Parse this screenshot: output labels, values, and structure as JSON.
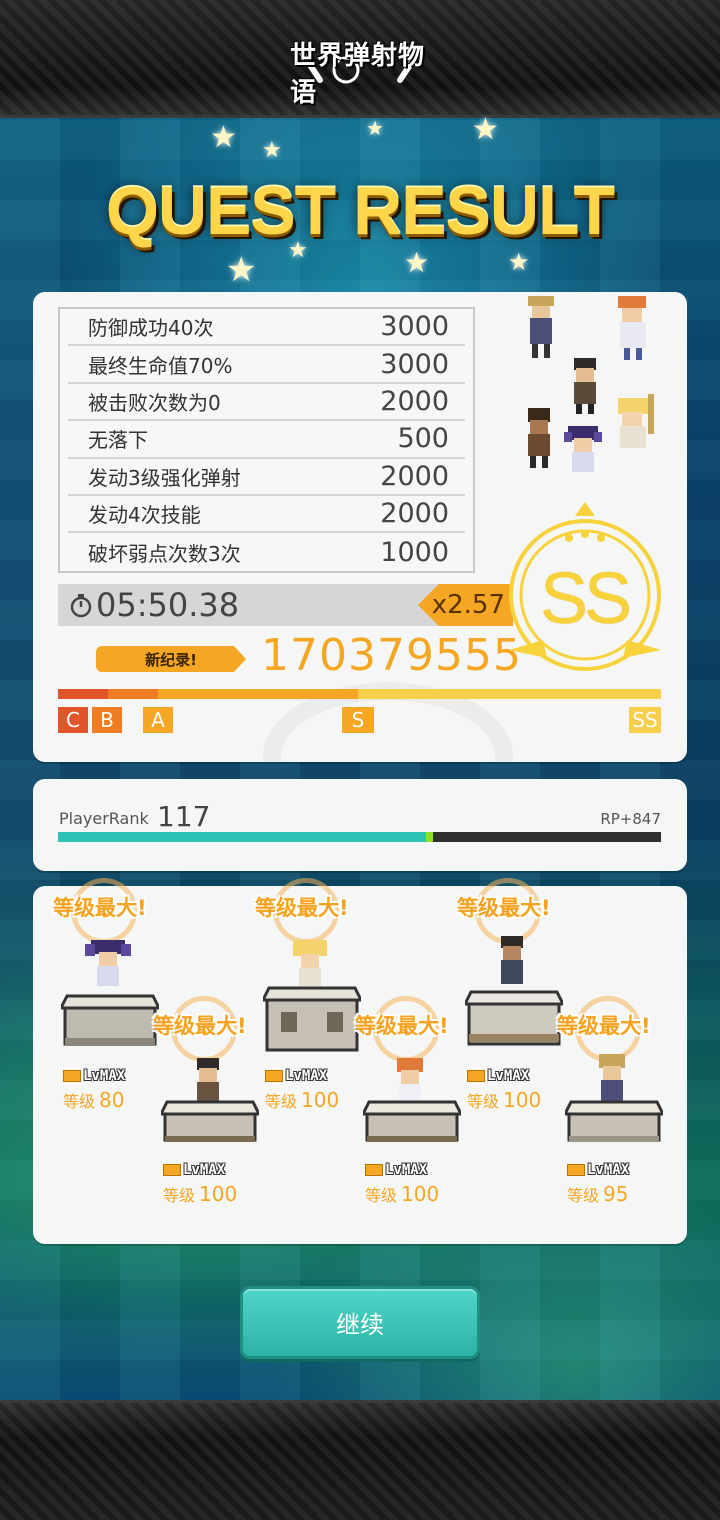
{
  "header": {
    "logo_text": "世界弹射物语"
  },
  "title": "QUEST RESULT",
  "bonuses": [
    {
      "label": "防御成功40次",
      "value": "3000"
    },
    {
      "label": "最终生命值70%",
      "value": "3000"
    },
    {
      "label": "被击败次数为0",
      "value": "2000"
    },
    {
      "label": "无落下",
      "value": "500"
    },
    {
      "label": "发动3级强化弹射",
      "value": "2000"
    },
    {
      "label": "发动4次技能",
      "value": "2000"
    },
    {
      "label": "破坏弱点次数3次",
      "value": "1000"
    }
  ],
  "result": {
    "time": "05:50.38",
    "multiplier": "x2.57",
    "new_record_label": "新纪录!",
    "score": "170379555",
    "grade": "SS",
    "rank_marks": [
      "C",
      "B",
      "A",
      "S",
      "SS"
    ],
    "icons": {
      "timer": "stopwatch-icon"
    }
  },
  "player": {
    "rank_label": "PlayerRank",
    "rank_value": "117",
    "rp": "RP+847",
    "progress": 0.61
  },
  "units": [
    {
      "level_label": "等级",
      "level": "80",
      "max_badge": "等级最大!",
      "tag": "LvMAX"
    },
    {
      "level_label": "等级",
      "level": "100",
      "max_badge": "等级最大!",
      "tag": "LvMAX"
    },
    {
      "level_label": "等级",
      "level": "100",
      "max_badge": "等级最大!",
      "tag": "LvMAX"
    },
    {
      "level_label": "等级",
      "level": "100",
      "max_badge": "等级最大!",
      "tag": "LvMAX"
    },
    {
      "level_label": "等级",
      "level": "100",
      "max_badge": "等级最大!",
      "tag": "LvMAX"
    },
    {
      "level_label": "等级",
      "level": "95",
      "max_badge": "等级最大!",
      "tag": "LvMAX"
    }
  ],
  "continue_label": "继续",
  "colors": {
    "accent": "#f5a623",
    "teal": "#2ec2b4",
    "gold": "#ffd54a"
  }
}
